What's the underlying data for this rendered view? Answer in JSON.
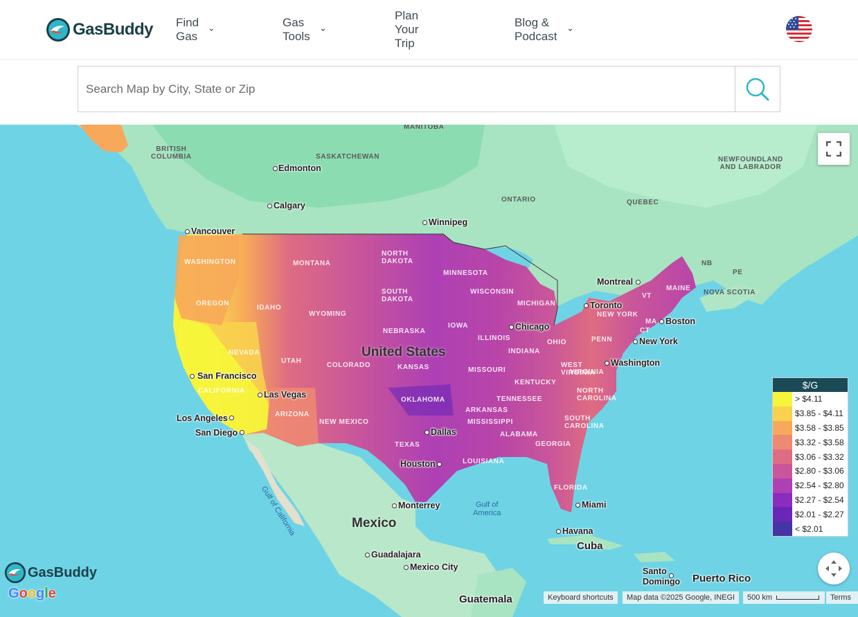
{
  "brand": {
    "name": "GasBuddy"
  },
  "nav": {
    "find_gas": "Find Gas",
    "gas_tools": "Gas Tools",
    "plan_trip": "Plan Your Trip",
    "blog_podcast": "Blog & Podcast"
  },
  "search": {
    "placeholder": "Search Map by City, State or Zip"
  },
  "map": {
    "regions": {
      "british_columbia": "BRITISH\nCOLUMBIA",
      "saskatchewan": "SASKATCHEWAN",
      "manitoba": "MANITOBA",
      "ontario": "ONTARIO",
      "quebec": "QUEBEC",
      "newfoundland": "NEWFOUNDLAND\nAND LABRADOR",
      "nb": "NB",
      "pe": "PE",
      "nova_scotia": "NOVA SCOTIA"
    },
    "states": {
      "washington": "WASHINGTON",
      "oregon": "OREGON",
      "idaho": "IDAHO",
      "montana": "MONTANA",
      "wyoming": "WYOMING",
      "nevada": "NEVADA",
      "utah": "UTAH",
      "california": "CALIFORNIA",
      "arizona": "ARIZONA",
      "colorado": "COLORADO",
      "new_mexico": "NEW MEXICO",
      "north_dakota": "NORTH\nDAKOTA",
      "south_dakota": "SOUTH\nDAKOTA",
      "nebraska": "NEBRASKA",
      "kansas": "KANSAS",
      "oklahoma": "OKLAHOMA",
      "texas": "TEXAS",
      "minnesota": "MINNESOTA",
      "iowa": "IOWA",
      "missouri": "MISSOURI",
      "arkansas": "ARKANSAS",
      "louisiana": "LOUISIANA",
      "wisconsin": "WISCONSIN",
      "illinois": "ILLINOIS",
      "michigan": "MICHIGAN",
      "indiana": "INDIANA",
      "ohio": "OHIO",
      "kentucky": "KENTUCKY",
      "tennessee": "TENNESSEE",
      "mississippi": "MISSISSIPPI",
      "alabama": "ALABAMA",
      "georgia": "GEORGIA",
      "florida": "FLORIDA",
      "south_carolina": "SOUTH\nCAROLINA",
      "north_carolina": "NORTH\nCAROLINA",
      "virginia": "VIRGINIA",
      "west_virginia": "WEST\nVIRGINIA",
      "penn": "PENN",
      "new_york": "NEW YORK",
      "maine": "MAINE",
      "vt": "VT",
      "ma": "MA",
      "ct": "CT"
    },
    "cities": {
      "edmonton": "Edmonton",
      "calgary": "Calgary",
      "vancouver": "Vancouver",
      "winnipeg": "Winnipeg",
      "montreal": "Montreal",
      "toronto": "Toronto",
      "boston": "Boston",
      "new_york": "New York",
      "washington": "Washington",
      "chicago": "Chicago",
      "san_francisco": "San Francisco",
      "las_vegas": "Las Vegas",
      "los_angeles": "Los Angeles",
      "san_diego": "San Diego",
      "dallas": "Dallas",
      "houston": "Houston",
      "monterrey": "Monterrey",
      "miami": "Miami",
      "havana": "Havana",
      "guadalajara": "Guadalajara",
      "mexico_city": "Mexico City",
      "santo_domingo": "Santo\nDomingo",
      "puerto_rico": "Puerto Rico",
      "cuba": "Cuba",
      "guatemala": "Guatemala"
    },
    "countries": {
      "united_states": "United States",
      "mexico": "Mexico"
    },
    "water": {
      "gulf_of_mexico": "Gulf of\nAmerica",
      "gulf_of_california": "Gulf of California"
    }
  },
  "legend": {
    "title": "$/G",
    "entries": [
      {
        "label": "> $4.11",
        "color": "#f7f53a"
      },
      {
        "label": "$3.85 - $4.11",
        "color": "#f8d24e"
      },
      {
        "label": "$3.58 - $3.85",
        "color": "#f7a85a"
      },
      {
        "label": "$3.32 - $3.58",
        "color": "#ee8a72"
      },
      {
        "label": "$3.06 - $3.32",
        "color": "#de6c82"
      },
      {
        "label": "$2.80 - $3.06",
        "color": "#c9569a"
      },
      {
        "label": "$2.54 - $2.80",
        "color": "#ad40b4"
      },
      {
        "label": "$2.27 - $2.54",
        "color": "#8a2cbf"
      },
      {
        "label": "$2.01 - $2.27",
        "color": "#6a26b8"
      },
      {
        "label": "< $2.01",
        "color": "#4535a4"
      }
    ]
  },
  "attribution": {
    "keyboard": "Keyboard shortcuts",
    "map_data": "Map data ©2025 Google, INEGI",
    "scale": "500 km",
    "terms": "Terms"
  },
  "google": {
    "letters": [
      "G",
      "o",
      "o",
      "g",
      "l",
      "e"
    ]
  },
  "icons": {
    "search": "search-icon",
    "fullscreen": "fullscreen-icon",
    "pan": "pan-arrows-icon",
    "flag": "us-flag-icon"
  }
}
